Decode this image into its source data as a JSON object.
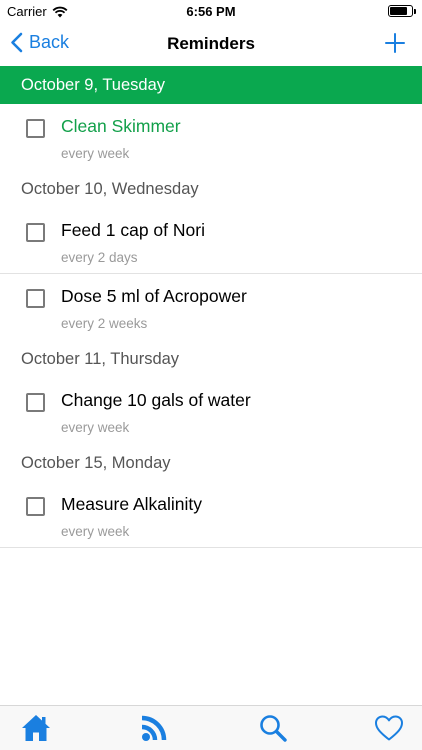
{
  "status_bar": {
    "carrier": "Carrier",
    "time": "6:56 PM",
    "wifi_icon": "wifi-icon",
    "battery_icon": "battery-icon"
  },
  "nav": {
    "back_label": "Back",
    "title": "Reminders",
    "add_icon": "plus-icon"
  },
  "colors": {
    "accent": "#1a7fe0",
    "today_header": "#0aa84f",
    "due_text": "#12a04a"
  },
  "sections": [
    {
      "date": "October 9, Tuesday",
      "items": [
        {
          "title": "Clean Skimmer",
          "repeat": "every week"
        }
      ]
    },
    {
      "date": "October 10, Wednesday",
      "items": [
        {
          "title": "Feed 1 cap of Nori",
          "repeat": "every 2 days"
        },
        {
          "title": "Dose 5 ml of Acropower",
          "repeat": "every 2 weeks"
        }
      ]
    },
    {
      "date": "October 11, Thursday",
      "items": [
        {
          "title": "Change 10 gals of water",
          "repeat": "every week"
        }
      ]
    },
    {
      "date": "October 15, Monday",
      "items": [
        {
          "title": "Measure Alkalinity",
          "repeat": "every week"
        }
      ]
    }
  ],
  "tab_bar": {
    "icons": [
      "home-icon",
      "rss-icon",
      "search-icon",
      "heart-icon"
    ]
  }
}
